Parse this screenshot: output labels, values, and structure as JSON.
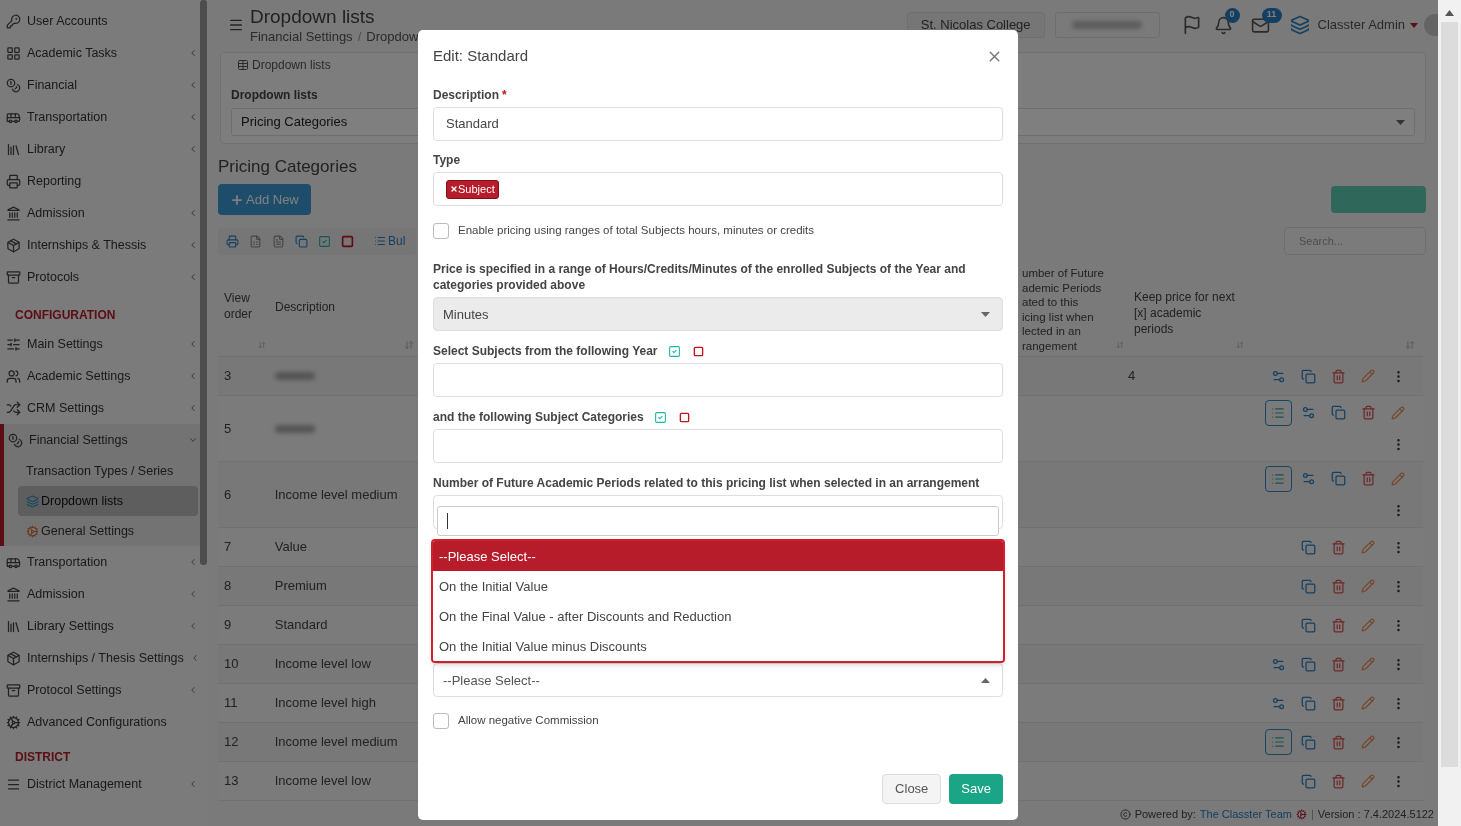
{
  "sidebar": {
    "groups": [
      {
        "items": [
          {
            "label": "User Accounts",
            "expandable": false,
            "expanded": false
          },
          {
            "label": "Academic Tasks",
            "expandable": true,
            "expanded": false
          },
          {
            "label": "Financial",
            "expandable": true,
            "expanded": false
          },
          {
            "label": "Transportation",
            "expandable": true,
            "expanded": false
          },
          {
            "label": "Library",
            "expandable": true,
            "expanded": false
          },
          {
            "label": "Reporting",
            "expandable": false,
            "expanded": false
          },
          {
            "label": "Admission",
            "expandable": true,
            "expanded": false
          },
          {
            "label": "Internships & Thessis",
            "expandable": true,
            "expanded": false
          },
          {
            "label": "Protocols",
            "expandable": true,
            "expanded": false
          }
        ]
      },
      {
        "heading": "CONFIGURATION",
        "items": [
          {
            "label": "Main Settings",
            "expandable": true,
            "expanded": false
          },
          {
            "label": "Academic Settings",
            "expandable": true,
            "expanded": false
          },
          {
            "label": "CRM Settings",
            "expandable": true,
            "expanded": false
          },
          {
            "label": "Financial Settings",
            "expandable": true,
            "expanded": true,
            "children": [
              {
                "label": "Transaction Types / Series",
                "selected": false
              },
              {
                "label": "Dropdown lists",
                "selected": true
              },
              {
                "label": "General Settings",
                "selected": false
              }
            ]
          },
          {
            "label": "Transportation",
            "expandable": true,
            "expanded": false
          },
          {
            "label": "Admission",
            "expandable": true,
            "expanded": false
          },
          {
            "label": "Library Settings",
            "expandable": true,
            "expanded": false
          },
          {
            "label": "Internships / Thesis Settings",
            "expandable": true,
            "expanded": false
          },
          {
            "label": "Protocol Settings",
            "expandable": true,
            "expanded": false
          },
          {
            "label": "Advanced Configurations",
            "expandable": false,
            "expanded": false
          }
        ]
      },
      {
        "heading": "DISTRICT",
        "items": [
          {
            "label": "District Management",
            "expandable": true,
            "expanded": false
          }
        ]
      }
    ]
  },
  "header": {
    "title": "Dropdown lists",
    "breadcrumb": [
      "Financial Settings",
      "Dropdow"
    ],
    "breadcrumb_separator": "/",
    "school": "St. Nicolas College",
    "notifications": "0",
    "messages": "11",
    "user": "Classter Admin"
  },
  "card": {
    "tab": "Dropdown lists",
    "label": "Dropdown lists",
    "value": "Pricing Categories"
  },
  "section": {
    "title": "Pricing Categories",
    "add_button": "Add New",
    "bulk": "Bul",
    "search_placeholder": "Search..."
  },
  "table": {
    "columns": [
      {
        "label": "View order"
      },
      {
        "label": "Description"
      },
      {
        "lines": [
          "umber of Future",
          "ademic Periods",
          "ated to this",
          "icing list when",
          "lected in an",
          "rangement"
        ]
      },
      {
        "label": "Keep price for next [x] academic periods"
      }
    ],
    "rows": [
      {
        "order": "3",
        "keep": "4",
        "list": false,
        "gear": true
      },
      {
        "order": "5",
        "list": true,
        "gear": true
      },
      {
        "order": "6",
        "description": "Income level medium",
        "list": true,
        "gear": true
      },
      {
        "order": "7",
        "description": "Value",
        "list": false,
        "gear": false
      },
      {
        "order": "8",
        "description": "Premium",
        "list": false,
        "gear": false
      },
      {
        "order": "9",
        "description": "Standard",
        "list": false,
        "gear": false
      },
      {
        "order": "10",
        "description": "Income level low",
        "list": false,
        "gear": true
      },
      {
        "order": "11",
        "description": "Income level high",
        "list": false,
        "gear": true
      },
      {
        "order": "12",
        "description": "Income level medium",
        "list": true,
        "gear": false
      },
      {
        "order": "13",
        "description": "Income level low",
        "list": false,
        "gear": false
      }
    ]
  },
  "footer": {
    "powered": "Powered by:",
    "team": "The Classter Team",
    "separator": "|",
    "version": "Version : 7.4.2024.5122"
  },
  "modal": {
    "title": "Edit: Standard",
    "fields": [
      {
        "kind": "text",
        "label": "Description",
        "required_mark": "*",
        "value": "Standard"
      },
      {
        "kind": "tags",
        "label": "Type",
        "tags": [
          "Subject"
        ]
      },
      {
        "kind": "checkbox",
        "label": "Enable pricing using ranges of total Subjects hours, minutes or credits",
        "checked": false
      },
      {
        "kind": "select",
        "label": "Price is specified in a range of Hours/Credits/Minutes of the enrolled Subjects of the Year and categories provided above",
        "value": "Minutes",
        "disabled": true,
        "open": false
      },
      {
        "kind": "multi",
        "label": "Select Subjects from the following Year"
      },
      {
        "kind": "multi",
        "label": "and the following Subject Categories"
      },
      {
        "kind": "select",
        "label": "Number of Future Academic Periods related to this pricing list when selected in an arrangement"
      },
      {
        "kind": "select",
        "value": "--Please Select--",
        "disabled": false,
        "open": true
      },
      {
        "kind": "checkbox",
        "label": "Allow negative Commission",
        "checked": false
      }
    ],
    "dropdown": {
      "options": [
        {
          "label": "--Please Select--",
          "selected": true
        },
        {
          "label": "On the Initial Value",
          "selected": false
        },
        {
          "label": "On the Final Value - after Discounts and Reduction",
          "selected": false
        },
        {
          "label": "On the Initial Value minus Discounts",
          "selected": false
        }
      ]
    },
    "buttons": [
      {
        "label": "Close",
        "kind": "secondary"
      },
      {
        "label": "Save",
        "kind": "primary"
      }
    ]
  }
}
